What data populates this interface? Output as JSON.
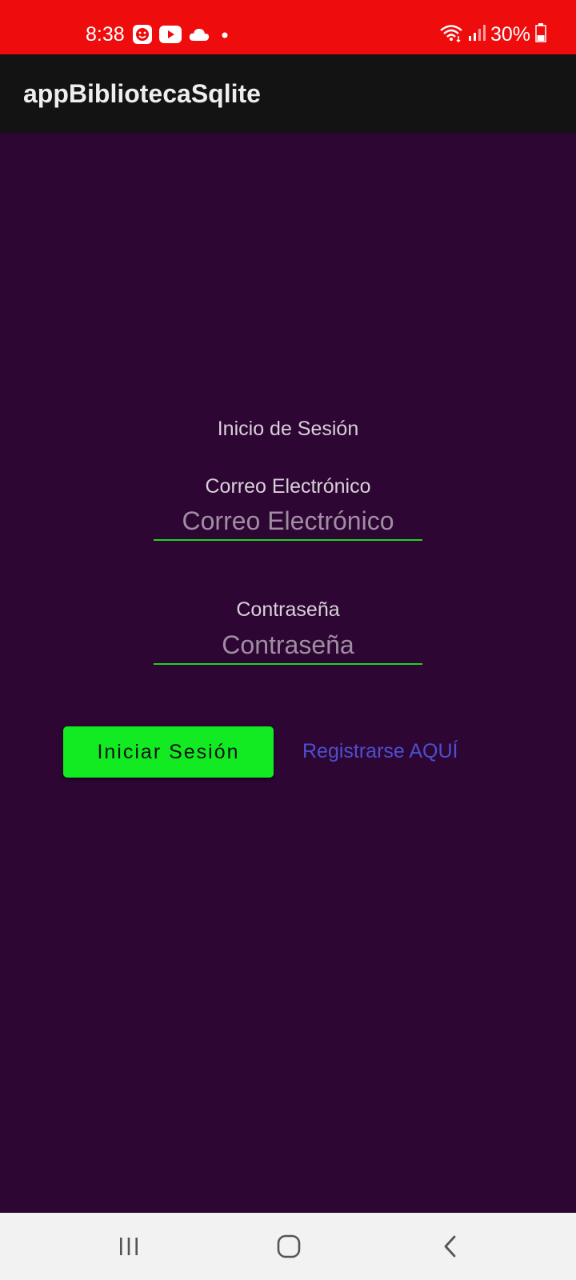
{
  "status_bar": {
    "time": "8:38",
    "battery": "30%",
    "icons_left": [
      "smiley-notification-icon",
      "youtube-icon",
      "cloud-icon",
      "dot-icon"
    ],
    "icons_right": [
      "wifi-icon",
      "signal-icon",
      "battery-icon"
    ],
    "color": "#ee0c0c"
  },
  "app_bar": {
    "title": "appBibliotecaSqlite"
  },
  "login": {
    "heading": "Inicio de Sesión",
    "email_label": "Correo Electrónico",
    "email_placeholder": "Correo Electrónico",
    "email_value": "",
    "password_label": "Contraseña",
    "password_placeholder": "Contraseña",
    "password_value": "",
    "login_button": "Iniciar Sesión",
    "register_link": "Registrarse AQUÍ"
  },
  "nav_bar": {
    "buttons": [
      "recent-apps-icon",
      "home-icon",
      "back-icon"
    ]
  },
  "colors": {
    "background": "#2d0634",
    "app_bar": "#131313",
    "button": "#12eb21",
    "link": "#4c50cd",
    "field_underline": "#1fd41f"
  }
}
